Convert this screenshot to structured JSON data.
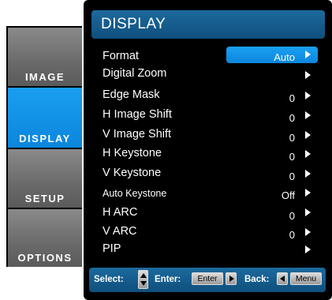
{
  "header": {
    "title": "DISPLAY"
  },
  "tabs": [
    {
      "label": "IMAGE"
    },
    {
      "label": "DISPLAY"
    },
    {
      "label": "SETUP"
    },
    {
      "label": "OPTIONS"
    }
  ],
  "items": [
    {
      "label": "Format",
      "value": "Auto"
    },
    {
      "label": "Digital Zoom",
      "value": ""
    },
    {
      "label": "Edge Mask",
      "value": "0"
    },
    {
      "label": "H Image Shift",
      "value": "0"
    },
    {
      "label": "V Image Shift",
      "value": "0"
    },
    {
      "label": "H Keystone",
      "value": "0"
    },
    {
      "label": "V Keystone",
      "value": "0"
    },
    {
      "label": "Auto Keystone",
      "value": "Off"
    },
    {
      "label": "H ARC",
      "value": "0"
    },
    {
      "label": "V ARC",
      "value": "0"
    },
    {
      "label": "PIP",
      "value": ""
    }
  ],
  "footer": {
    "select_label": "Select:",
    "enter_label": "Enter:",
    "enter_key": "Enter",
    "back_label": "Back:",
    "menu_key": "Menu"
  },
  "colors": {
    "accent": "#0b86dc",
    "header": "#0f4f7c",
    "tab_gray": "#6a6a6a"
  }
}
